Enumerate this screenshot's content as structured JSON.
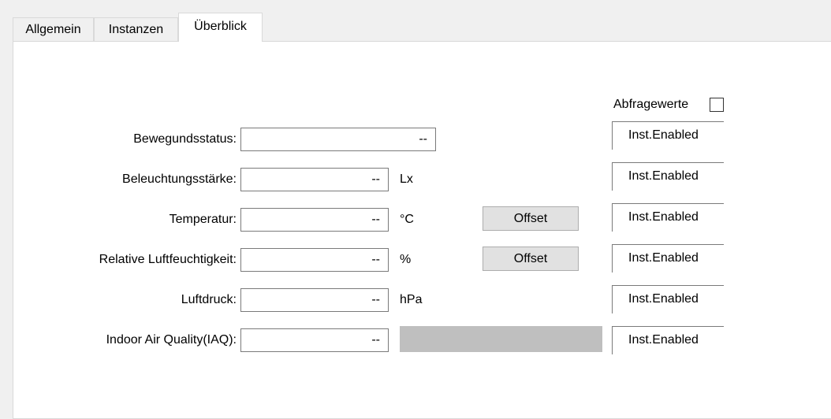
{
  "tabs": [
    {
      "label": "Allgemein",
      "active": false
    },
    {
      "label": "Instanzen",
      "active": false
    },
    {
      "label": "Überblick",
      "active": true
    }
  ],
  "poll": {
    "label": "Abfragewerte",
    "checked": false
  },
  "rows": [
    {
      "label": "Bewegundsstatus:",
      "value": "--",
      "unit": "",
      "offset_label": "",
      "status": "Inst.Enabled"
    },
    {
      "label": "Beleuchtungsstärke:",
      "value": "--",
      "unit": "Lx",
      "offset_label": "",
      "status": "Inst.Enabled"
    },
    {
      "label": "Temperatur:",
      "value": "--",
      "unit": "°C",
      "offset_label": "Offset",
      "status": "Inst.Enabled"
    },
    {
      "label": "Relative Luftfeuchtigkeit:",
      "value": "--",
      "unit": "%",
      "offset_label": "Offset",
      "status": "Inst.Enabled"
    },
    {
      "label": "Luftdruck:",
      "value": "--",
      "unit": "hPa",
      "offset_label": "",
      "status": "Inst.Enabled"
    },
    {
      "label": "Indoor Air Quality(IAQ):",
      "value": "--",
      "unit": "",
      "offset_label": "",
      "status": "Inst.Enabled"
    }
  ],
  "colors": {
    "window_bg": "#f0f0f0",
    "panel_bg": "#ffffff",
    "field_border": "#7a7a7a",
    "button_bg": "#e1e1e1",
    "iaq_bar": "#bfbfbf"
  }
}
